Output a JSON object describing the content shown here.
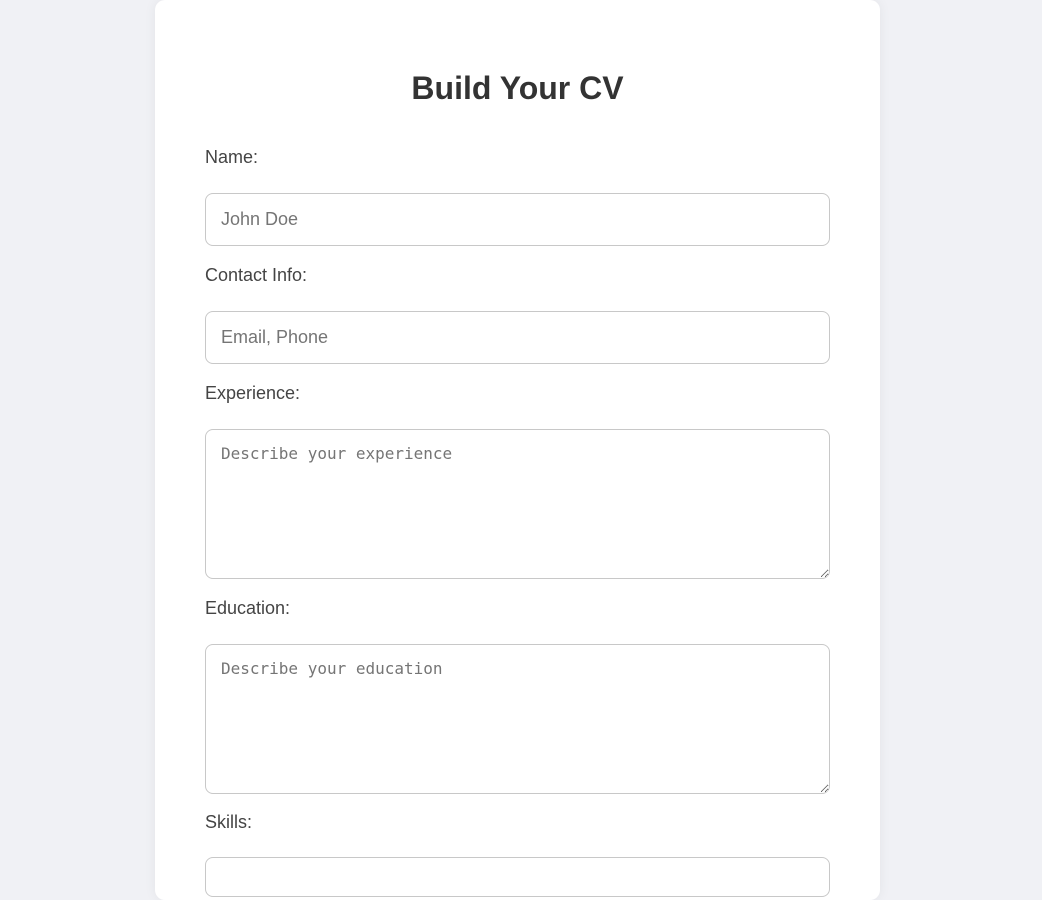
{
  "form": {
    "title": "Build Your CV",
    "fields": {
      "name": {
        "label": "Name:",
        "placeholder": "John Doe",
        "value": ""
      },
      "contact": {
        "label": "Contact Info:",
        "placeholder": "Email, Phone",
        "value": ""
      },
      "experience": {
        "label": "Experience:",
        "placeholder": "Describe your experience",
        "value": ""
      },
      "education": {
        "label": "Education:",
        "placeholder": "Describe your education",
        "value": ""
      },
      "skills": {
        "label": "Skills:"
      }
    }
  },
  "colors": {
    "background": "#f0f1f5",
    "card": "#ffffff",
    "title_text": "#333333",
    "label_text": "#444444",
    "field_border": "#c8c8c8",
    "placeholder_text": "#757575"
  }
}
